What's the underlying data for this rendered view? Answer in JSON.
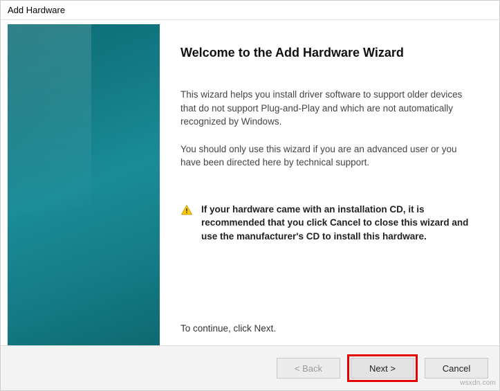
{
  "window": {
    "title": "Add Hardware"
  },
  "main": {
    "heading": "Welcome to the Add Hardware Wizard",
    "para1": "This wizard helps you install driver software to support older devices that do not support Plug-and-Play and which are not automatically recognized by Windows.",
    "para2": "You should only use this wizard if you are an advanced user or you have been directed here by technical support.",
    "warning": "If your hardware came with an installation CD, it is recommended that you click Cancel to close this wizard and use the manufacturer's CD to install this hardware.",
    "continue": "To continue, click Next."
  },
  "footer": {
    "back": "< Back",
    "next": "Next >",
    "cancel": "Cancel"
  },
  "watermark": "wsxdn.com"
}
